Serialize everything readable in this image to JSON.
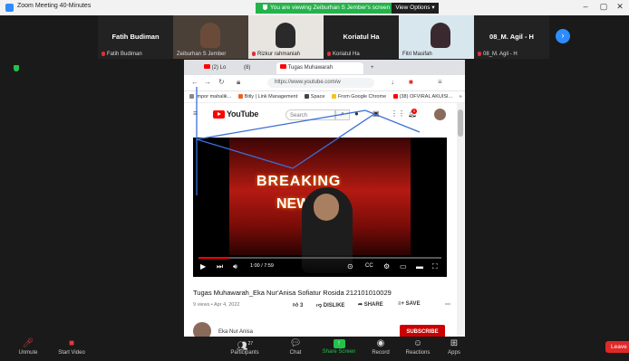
{
  "zoom": {
    "window_title": "Zoom Meeting 40-Minutes",
    "share_banner": "You are viewing Zeiburhan S Jember's screen",
    "view_options": "View Options",
    "window_buttons": {
      "minimize": "–",
      "maximize": "▢",
      "close": "✕"
    },
    "next_page": "›"
  },
  "gallery": [
    {
      "big_name": "Fatih Budiman",
      "label": "Fatih Budiman",
      "video": false
    },
    {
      "big_name": "",
      "label": "Zeiburhan S Jember",
      "video": true,
      "face": "#6a4b3a",
      "bg": "#4a4038"
    },
    {
      "big_name": "",
      "label": "Rizkur rahmaniah",
      "video": true,
      "face": "#2a2a2a",
      "bg": "#e8e4e0"
    },
    {
      "big_name": "Koriatul Ha",
      "label": "Koriatul Ha",
      "video": false
    },
    {
      "big_name": "",
      "label": "Fitri Masifah",
      "video": true,
      "face": "#3a2a30",
      "bg": "#d8e6ee"
    },
    {
      "big_name": "08_M. Agil - H",
      "label": "08_M. Agil - H",
      "video": false
    }
  ],
  "browser": {
    "tabs": [
      "(2) Lo",
      "(8)",
      "Tugas Muhawarah",
      "+"
    ],
    "url": "https://www.youtube.com/w",
    "bookmarks": [
      "Impor mahalik...",
      "Bitly | Link Management",
      "Space",
      "From Google Chrome",
      "(38) OFVIRAL AKUISI..."
    ],
    "bookmark_more": "»"
  },
  "youtube": {
    "brand": "YouTube",
    "search_placeholder": "Search",
    "notification_count": "1",
    "video_overlay_line1": "BREAKING",
    "video_overlay_line2": "NEWS",
    "time": "1:00 / 7:59",
    "progress_fraction": 0.125,
    "title": "Tugas Muhawarah_Eka Nur'Anisa Sofiatur Rosida 212101010029",
    "meta": "9 views • Apr 4, 2022",
    "likes": "3",
    "dislike": "DISLIKE",
    "share": "SHARE",
    "save": "SAVE",
    "channel": "Eka Nur Anisa",
    "subscribe": "SUBSCRIBE"
  },
  "toolbar": {
    "unmute": "Unmute",
    "start_video": "Start Video",
    "participants": "Participants",
    "participants_count": "27",
    "chat": "Chat",
    "share_screen": "Share Screen",
    "record": "Record",
    "reactions": "Reactions",
    "apps": "Apps",
    "leave": "Leave"
  }
}
